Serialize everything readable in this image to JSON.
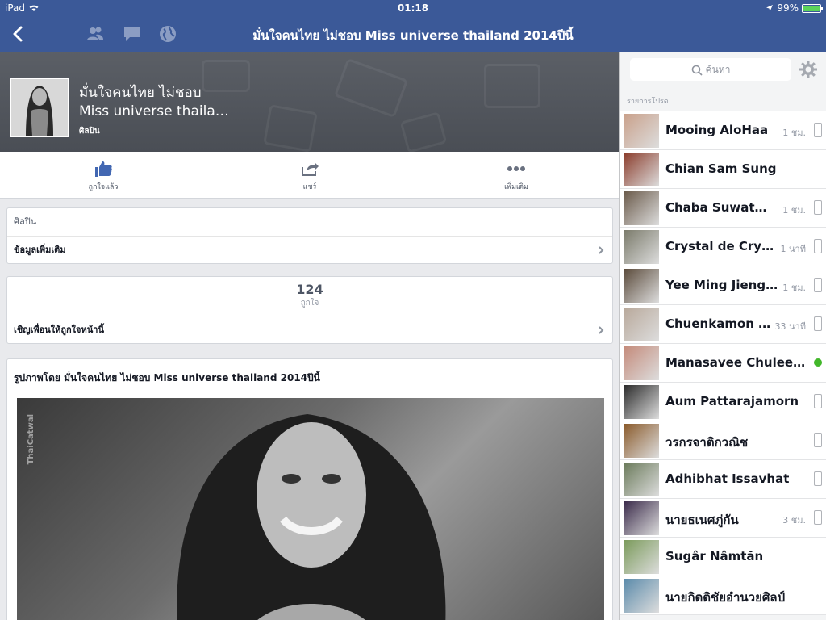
{
  "status_bar": {
    "device": "iPad",
    "time": "01:18",
    "battery": "99%",
    "battery_level": 0.99
  },
  "navbar": {
    "title": "มั่นใจคนไทย ไม่ชอบ Miss universe thailand 2014ปีนี้"
  },
  "page": {
    "name_line1": "มั่นใจคนไทย ไม่ชอบ",
    "name_line2": "Miss universe thaila…",
    "category": "ศิลปิน"
  },
  "actions": [
    {
      "label": "ถูกใจแล้ว",
      "icon": "thumbs-up-icon"
    },
    {
      "label": "แชร์",
      "icon": "share-icon"
    },
    {
      "label": "เพิ่มเติม",
      "icon": "more-icon"
    }
  ],
  "about_card": {
    "category": "ศิลปิน",
    "more_info": "ข้อมูลเพิ่มเติม"
  },
  "likes_card": {
    "count": "124",
    "label": "ถูกใจ",
    "invite": "เชิญเพื่อนให้ถูกใจหน้านี้"
  },
  "post": {
    "caption": "รูปภาพโดย มั่นใจคนไทย ไม่ชอบ Miss universe thailand 2014ปีนี้",
    "watermark": "ThaiCatwal"
  },
  "sidebar": {
    "search_placeholder": "ค้นหา",
    "section_label": "รายการโปรด",
    "friends": [
      {
        "name": "Mooing AloHaa",
        "status": "1 ชม.",
        "indicator": "phone",
        "avatar_color": "#c9a08a"
      },
      {
        "name": "Chian Sam Sung",
        "status": "",
        "indicator": "none",
        "avatar_color": "#8a3b2a"
      },
      {
        "name": "Chaba Suwatma…",
        "status": "1 ชม.",
        "indicator": "phone",
        "avatar_color": "#6a5a4a"
      },
      {
        "name": "Crystal de Crystal",
        "status": "1 นาที",
        "indicator": "phone",
        "avatar_color": "#7a7a6a"
      },
      {
        "name": "Yee Ming Jieng…",
        "status": "1 ชม.",
        "indicator": "phone",
        "avatar_color": "#5a4a3a"
      },
      {
        "name": "Chuenkamon C…",
        "status": "33 นาที",
        "indicator": "phone",
        "avatar_color": "#b8a89a"
      },
      {
        "name": "Manasavee Chuleew…",
        "status": "",
        "indicator": "online",
        "avatar_color": "#c48a7a"
      },
      {
        "name": "Aum Pattarajamorn",
        "status": "",
        "indicator": "phone",
        "avatar_color": "#2a2a2a"
      },
      {
        "name": "วรกรจาติกวณิช",
        "status": "",
        "indicator": "phone",
        "avatar_color": "#8a5a2a"
      },
      {
        "name": "Adhibhat Issavhat",
        "status": "",
        "indicator": "phone",
        "avatar_color": "#6a7a5a"
      },
      {
        "name": "นายธเนศภู่กัน",
        "status": "3 ชม.",
        "indicator": "phone",
        "avatar_color": "#3a2a4a"
      },
      {
        "name": "Sugâr Nâmtăn",
        "status": "",
        "indicator": "none",
        "avatar_color": "#7a9a5a"
      },
      {
        "name": "นายกิตติชัยอำนวยศิลป์",
        "status": "",
        "indicator": "none",
        "avatar_color": "#5a8aaa"
      }
    ]
  },
  "colors": {
    "brand": "#3b5998",
    "online": "#42b72a",
    "like_blue": "#4267b2"
  }
}
